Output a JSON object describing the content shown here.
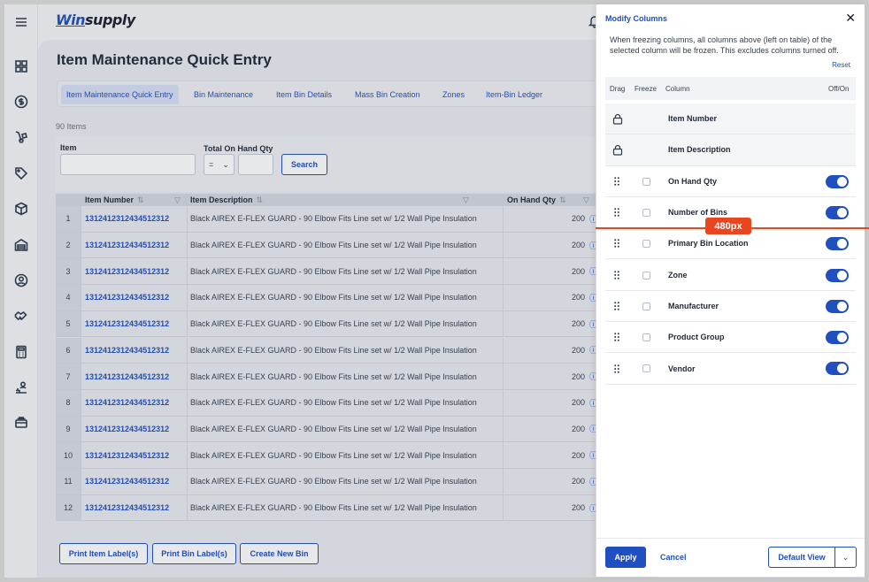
{
  "app": {
    "logo_prefix": "Win",
    "logo_suffix": "supply"
  },
  "rail": {
    "items": [
      {
        "icon": "hamburger-menu-icon"
      },
      {
        "icon": "dashboard-grid-icon"
      },
      {
        "icon": "dollar-circle-icon"
      },
      {
        "icon": "hand-truck-icon"
      },
      {
        "icon": "tag-icon"
      },
      {
        "icon": "box-icon"
      },
      {
        "icon": "warehouse-icon"
      },
      {
        "icon": "user-circle-icon"
      },
      {
        "icon": "handshake-icon"
      },
      {
        "icon": "calculator-icon"
      },
      {
        "icon": "person-stack-icon"
      },
      {
        "icon": "cards-stack-icon"
      }
    ]
  },
  "page": {
    "title": "Item Maintenance Quick Entry",
    "count": "90 Items"
  },
  "tabs": [
    {
      "label": "Item Maintenance Quick Entry",
      "active": true
    },
    {
      "label": "Bin Maintenance",
      "active": false
    },
    {
      "label": "Item Bin Details",
      "active": false
    },
    {
      "label": "Mass Bin Creation",
      "active": false
    },
    {
      "label": "Zones",
      "active": false
    },
    {
      "label": "Item-Bin Ledger",
      "active": false
    }
  ],
  "filters": {
    "item_label": "Item",
    "item_value": "",
    "qty_label": "Total On Hand Qty",
    "qty_operator": "=",
    "qty_value": "",
    "search_label": "Search"
  },
  "table": {
    "columns": {
      "item_number": "Item Number",
      "item_description": "Item Description",
      "on_hand_qty": "On Hand Qty"
    },
    "rows": [
      {
        "n": "1",
        "item": "1312412312434512312",
        "desc": "Black AIREX E-FLEX GUARD - 90 Elbow Fits Line set w/ 1/2 Wall Pipe Insulation",
        "qty": "200"
      },
      {
        "n": "2",
        "item": "1312412312434512312",
        "desc": "Black AIREX E-FLEX GUARD - 90 Elbow Fits Line set w/ 1/2 Wall Pipe Insulation",
        "qty": "200"
      },
      {
        "n": "3",
        "item": "1312412312434512312",
        "desc": "Black AIREX E-FLEX GUARD - 90 Elbow Fits Line set w/ 1/2 Wall Pipe Insulation",
        "qty": "200"
      },
      {
        "n": "4",
        "item": "1312412312434512312",
        "desc": "Black AIREX E-FLEX GUARD - 90 Elbow Fits Line set w/ 1/2 Wall Pipe Insulation",
        "qty": "200"
      },
      {
        "n": "5",
        "item": "1312412312434512312",
        "desc": "Black AIREX E-FLEX GUARD - 90 Elbow Fits Line set w/ 1/2 Wall Pipe Insulation",
        "qty": "200"
      },
      {
        "n": "6",
        "item": "1312412312434512312",
        "desc": "Black AIREX E-FLEX GUARD - 90 Elbow Fits Line set w/ 1/2 Wall Pipe Insulation",
        "qty": "200"
      },
      {
        "n": "7",
        "item": "1312412312434512312",
        "desc": "Black AIREX E-FLEX GUARD - 90 Elbow Fits Line set w/ 1/2 Wall Pipe Insulation",
        "qty": "200"
      },
      {
        "n": "8",
        "item": "1312412312434512312",
        "desc": "Black AIREX E-FLEX GUARD - 90 Elbow Fits Line set w/ 1/2 Wall Pipe Insulation",
        "qty": "200"
      },
      {
        "n": "9",
        "item": "1312412312434512312",
        "desc": "Black AIREX E-FLEX GUARD - 90 Elbow Fits Line set w/ 1/2 Wall Pipe Insulation",
        "qty": "200"
      },
      {
        "n": "10",
        "item": "1312412312434512312",
        "desc": "Black AIREX E-FLEX GUARD - 90 Elbow Fits Line set w/ 1/2 Wall Pipe Insulation",
        "qty": "200"
      },
      {
        "n": "11",
        "item": "1312412312434512312",
        "desc": "Black AIREX E-FLEX GUARD - 90 Elbow Fits Line set w/ 1/2 Wall Pipe Insulation",
        "qty": "200"
      },
      {
        "n": "12",
        "item": "1312412312434512312",
        "desc": "Black AIREX E-FLEX GUARD - 90 Elbow Fits Line set w/ 1/2 Wall Pipe Insulation",
        "qty": "200"
      }
    ]
  },
  "actions": {
    "print_item": "Print Item Label(s)",
    "print_bin": "Print Bin Label(s)",
    "create_bin": "Create New Bin"
  },
  "drawer": {
    "title": "Modify Columns",
    "close": "✕",
    "description": "When freezing columns, all columns above (left on table) of the selected column will be frozen. This excludes columns turned off.",
    "reset": "Reset",
    "headers": {
      "drag": "Drag",
      "freeze": "Freeze",
      "column": "Column",
      "onoff": "Off/On"
    },
    "columns": [
      {
        "label": "Item Number",
        "locked": true
      },
      {
        "label": "Item Description",
        "locked": true
      },
      {
        "label": "On Hand Qty",
        "locked": false,
        "on": true
      },
      {
        "label": "Number of Bins",
        "locked": false,
        "on": true
      },
      {
        "label": "Primary Bin Location",
        "locked": false,
        "on": true
      },
      {
        "label": "Zone",
        "locked": false,
        "on": true
      },
      {
        "label": "Manufacturer",
        "locked": false,
        "on": true
      },
      {
        "label": "Product Group",
        "locked": false,
        "on": true
      },
      {
        "label": "Vendor",
        "locked": false,
        "on": true
      }
    ],
    "apply": "Apply",
    "cancel": "Cancel",
    "default_view": "Default View"
  },
  "annotation": {
    "width_label": "480px"
  },
  "colors": {
    "accent": "#1f4fc0",
    "annotation": "#e8461f"
  }
}
